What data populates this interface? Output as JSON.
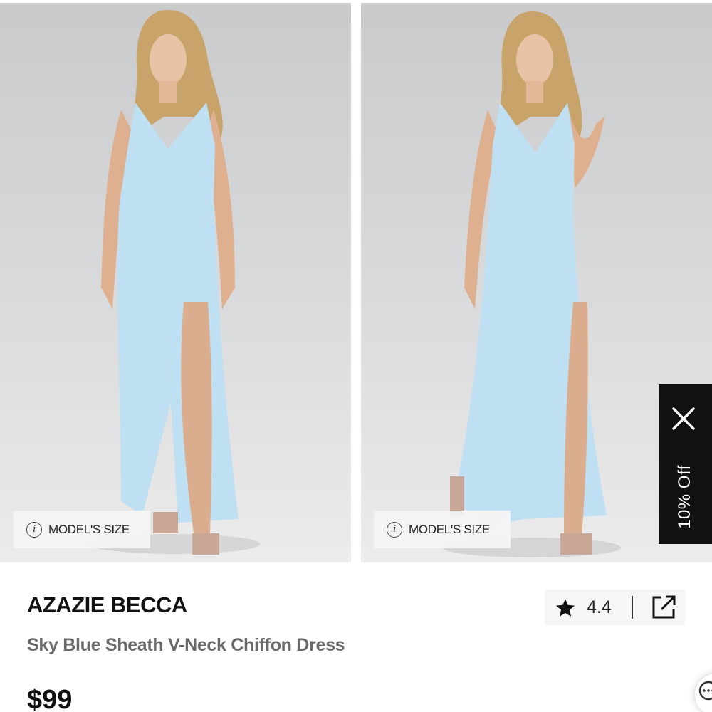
{
  "gallery": {
    "images": [
      {
        "alt": "model wearing sky blue dress, front view",
        "size_chip_label": "MODEL'S SIZE"
      },
      {
        "alt": "model wearing sky blue dress, angled view",
        "size_chip_label": "MODEL'S SIZE"
      }
    ]
  },
  "promo": {
    "label": "10% Off",
    "close_icon": "close-icon"
  },
  "product": {
    "brand": "AZAZIE BECCA",
    "name": "Sky Blue Sheath V-Neck Chiffon Dress",
    "price": "$99"
  },
  "rating": {
    "value": "4.4",
    "icon": "star-icon",
    "share_icon": "external-link-icon"
  },
  "chat": {
    "icon": "chat-icon"
  },
  "colors": {
    "dress": "#bfe0f2",
    "background": "#d6d7d9",
    "promo_bg": "#111111",
    "brand_text": "#111111",
    "name_text": "#6a6a6a"
  }
}
